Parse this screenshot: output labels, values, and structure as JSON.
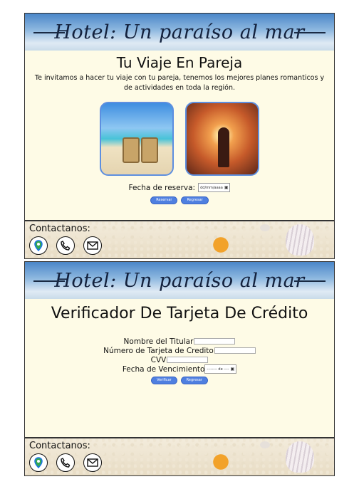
{
  "banner": {
    "title": "Hotel: Un paraíso al mar"
  },
  "page1": {
    "heading": "Tu Viaje En Pareja",
    "intro": "Te invitamos a hacer tu viaje con tu pareja, tenemos los mejores planes romanticos y de actividades en toda la región.",
    "reserve_label": "Fecha de reserva:",
    "date_placeholder": "dd/mm/aaaa",
    "buttons": {
      "primary": "Reservar",
      "secondary": "Regresar"
    }
  },
  "page2": {
    "heading": "Verificador De Tarjeta De Crédito",
    "fields": {
      "holder": "Nombre del Titular",
      "card_number": "Número de Tarjeta de Credito",
      "cvv": "CVV",
      "expiry": "Fecha de Vencimiento",
      "expiry_placeholder": "-------- de ----"
    },
    "buttons": {
      "primary": "Verificar",
      "secondary": "Regresar"
    }
  },
  "footer": {
    "label": "Contactanos:",
    "icons": [
      "map-pin-icon",
      "phone-icon",
      "mail-icon"
    ]
  },
  "colors": {
    "page_bg": "#fefbe6",
    "button": "#4f7fe0",
    "photo_border": "#5d8fe0"
  }
}
